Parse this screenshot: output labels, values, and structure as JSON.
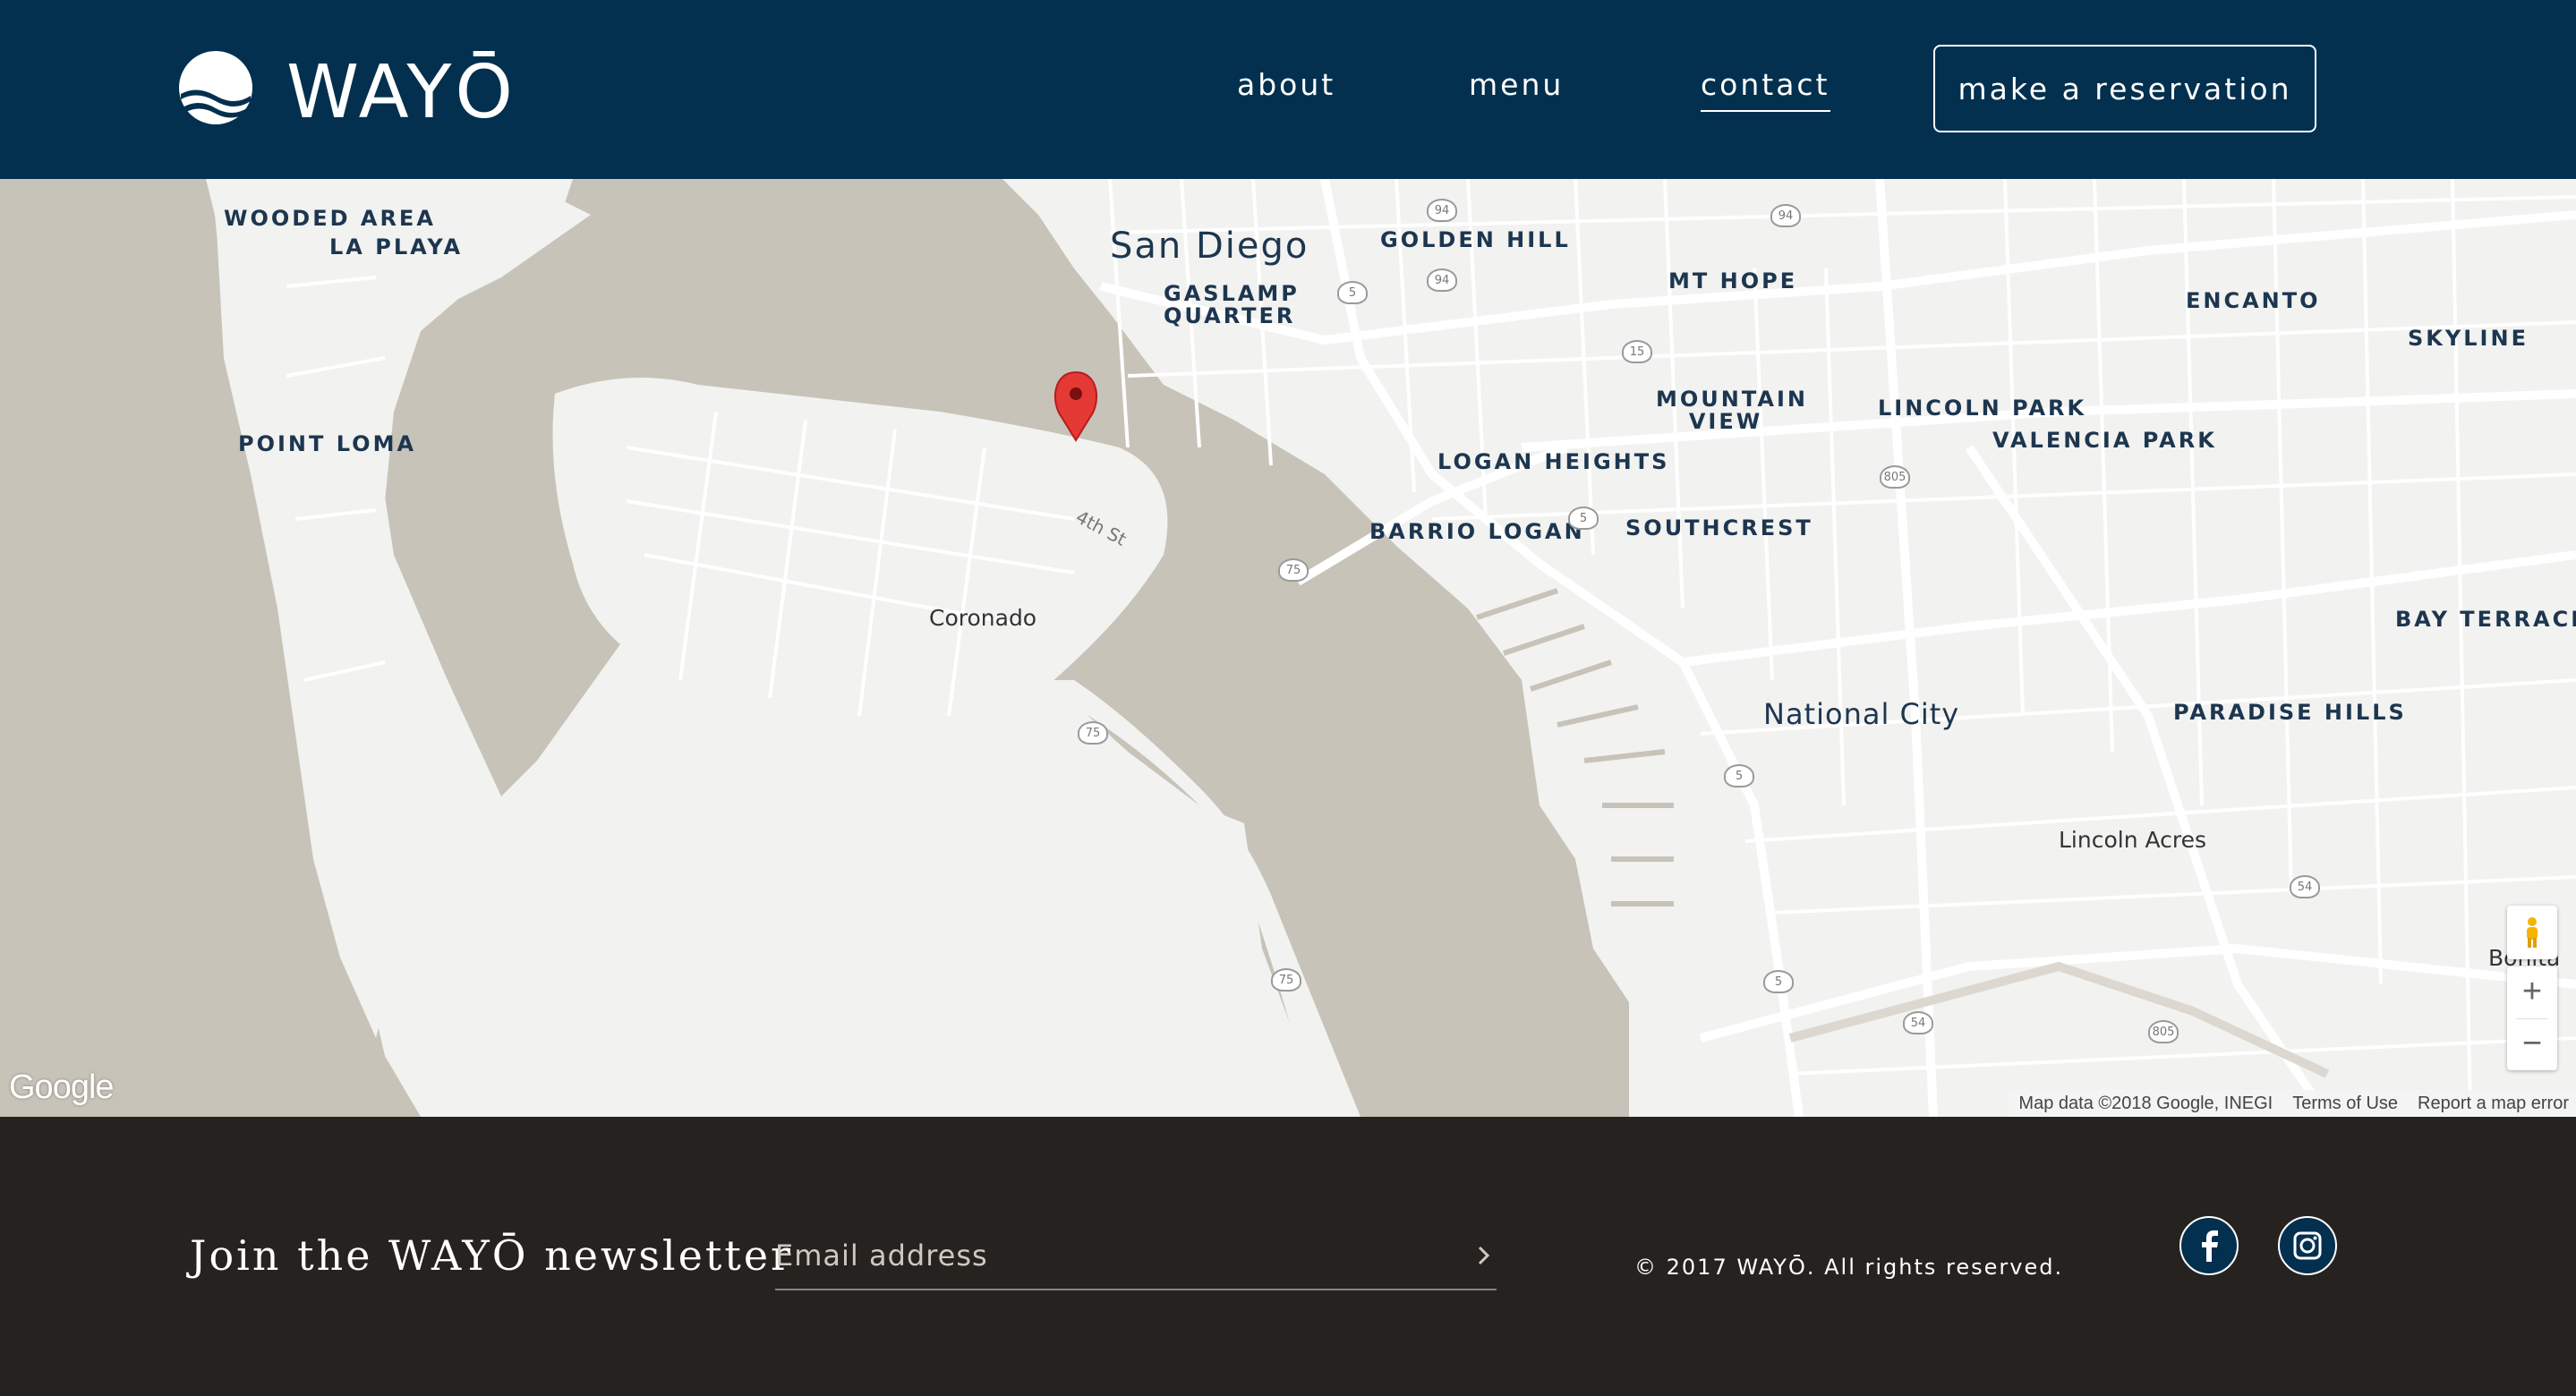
{
  "header": {
    "logo_text": "WAYŌ",
    "nav": [
      {
        "label": "about"
      },
      {
        "label": "menu"
      },
      {
        "label": "contact",
        "active": true
      }
    ],
    "reservation_label": "make a reservation",
    "background_color": "#03304f"
  },
  "map": {
    "marker_icon": "map-pin-icon",
    "labels": {
      "wooded_area": "WOODED AREA",
      "la_playa": "LA PLAYA",
      "point_loma": "POINT LOMA",
      "san_diego": "San Diego",
      "gaslamp": "GASLAMP QUARTER",
      "golden_hill": "GOLDEN HILL",
      "mt_hope": "MT HOPE",
      "encanto": "ENCANTO",
      "skyline": "SKYLINE",
      "mountain_view": "MOUNTAIN VIEW",
      "lincoln_park": "LINCOLN PARK",
      "valencia_park": "VALENCIA PARK",
      "logan_heights": "LOGAN HEIGHTS",
      "barrio_logan": "BARRIO LOGAN",
      "southcrest": "SOUTHCREST",
      "coronado": "Coronado",
      "national_city": "National City",
      "paradise_hills": "PARADISE HILLS",
      "bay_terraces": "BAY TERRACES",
      "lincoln_acres": "Lincoln Acres",
      "bonita": "Bonita",
      "fourth_st": "4th St"
    },
    "shields": [
      "94",
      "94",
      "94",
      "5",
      "15",
      "805",
      "5",
      "75",
      "75",
      "75",
      "5",
      "5",
      "54",
      "54",
      "805"
    ],
    "google_logo": "Google",
    "attribution": {
      "map_data": "Map data ©2018 Google, INEGI",
      "terms": "Terms of Use",
      "report": "Report a map error"
    },
    "zoom_in": "+",
    "zoom_out": "−",
    "colors": {
      "land": "#f2f2f0",
      "water": "#c7c3b8",
      "roads": "#ffffff",
      "marker": "#e53935"
    }
  },
  "footer": {
    "newsletter_title": "Join the WAYŌ newsletter",
    "email_placeholder": "Email address",
    "copyright": "© 2017 WAYŌ. All rights reserved.",
    "social": [
      {
        "icon": "facebook-icon"
      },
      {
        "icon": "instagram-icon"
      }
    ],
    "background_color": "#262220"
  }
}
